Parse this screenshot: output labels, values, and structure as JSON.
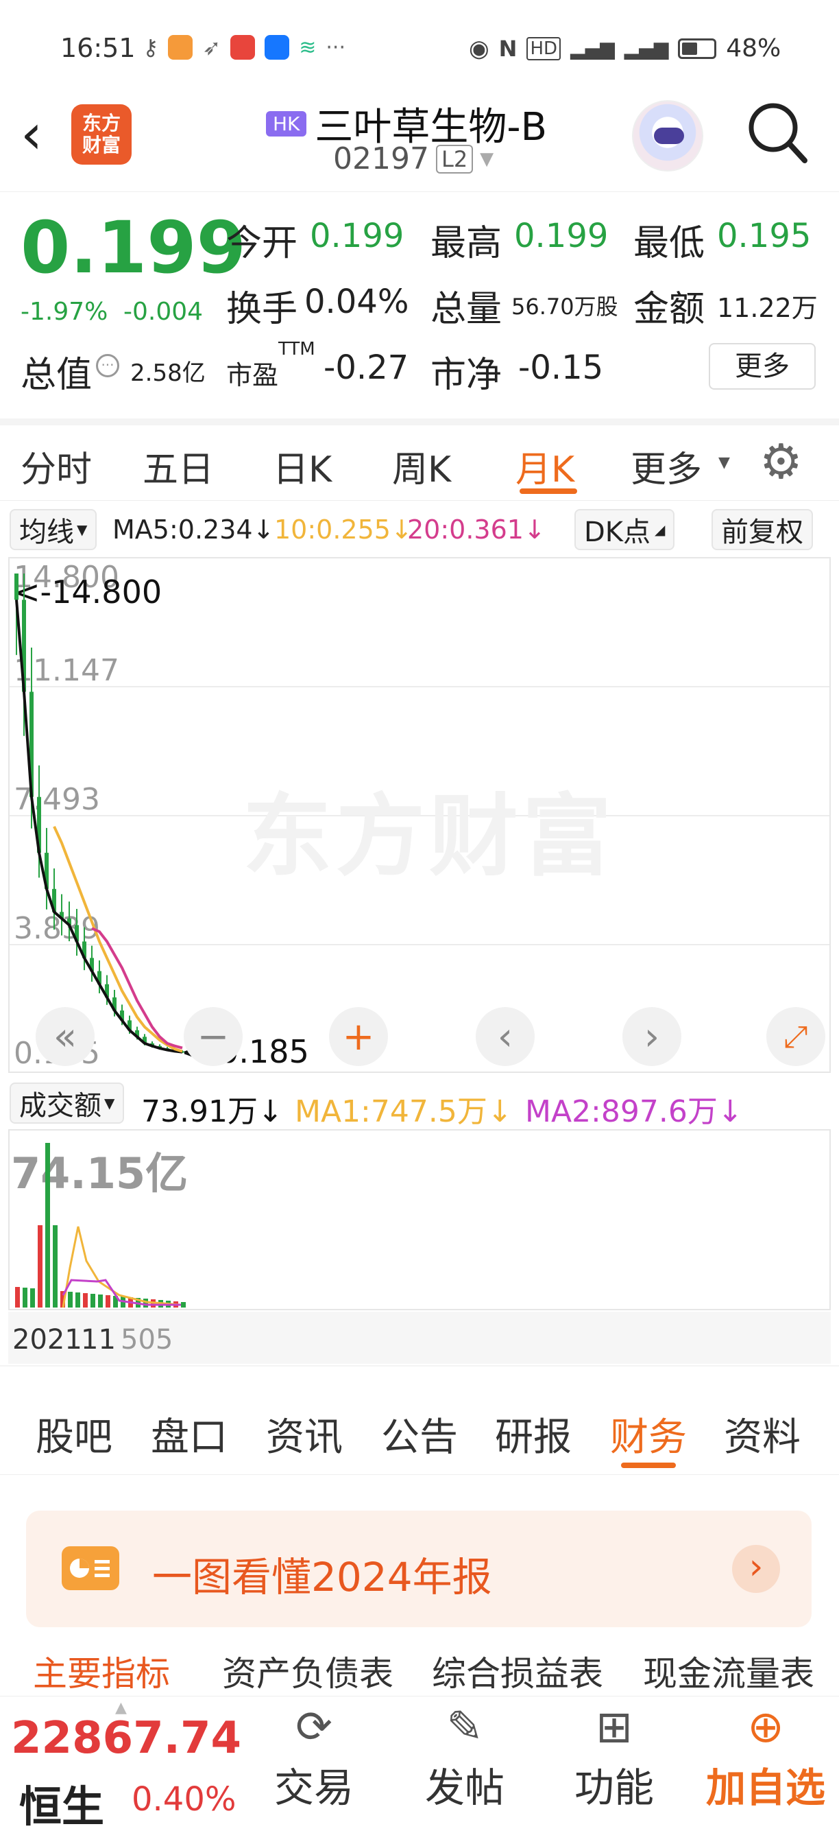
{
  "status": {
    "time": "16:51",
    "battery": "48%"
  },
  "header": {
    "market_badge": "HK",
    "stock_name": "三叶草生物-B",
    "code": "02197",
    "level": "L2",
    "logo_text": [
      "东方",
      "财富"
    ]
  },
  "quote": {
    "price": "0.199",
    "change_pct": "-1.97%",
    "change_abs": "-0.004",
    "open_label": "今开",
    "open": "0.199",
    "high_label": "最高",
    "high": "0.199",
    "low_label": "最低",
    "low": "0.195",
    "turnover_label": "换手",
    "turnover": "0.04%",
    "volume_label": "总量",
    "volume": "56.70万股",
    "amount_label": "金额",
    "amount": "11.22万",
    "mktcap_label": "总值",
    "mktcap": "2.58亿",
    "pe_label": "市盈",
    "pe_sup": "TTM",
    "pe": "-0.27",
    "pb_label": "市净",
    "pb": "-0.15",
    "more_button": "更多"
  },
  "tabs": {
    "items": [
      "分时",
      "五日",
      "日K",
      "周K",
      "月K",
      "更多"
    ],
    "active": "月K"
  },
  "ma_bar": {
    "dropdown": "均线",
    "ma5": "MA5:0.234↓",
    "ma10": "10:0.255↓",
    "ma20": "20:0.361↓",
    "dk": "DK点",
    "adjust": "前复权"
  },
  "chart": {
    "y_ticks": [
      "14.800",
      "11.147",
      "7.493",
      "3.839",
      "0.185"
    ],
    "max_marker": "<-14.800",
    "min_marker": "<-0.185",
    "watermark": "东方财富",
    "colors": {
      "ma5": "#111111",
      "ma10": "#f1b53a",
      "ma20": "#d43c8c",
      "up": "#e23b3b",
      "down": "#27a243"
    }
  },
  "chart_data": {
    "type": "line",
    "ylim": [
      0.185,
      14.8
    ],
    "series": [
      {
        "name": "MA5",
        "values": [
          14.0,
          11.2,
          8.0,
          6.3,
          5.2,
          4.5,
          4.3,
          4.1,
          3.6,
          3.1,
          2.7,
          2.3,
          1.9,
          1.5,
          1.2,
          0.9,
          0.7,
          0.5,
          0.42,
          0.35,
          0.3,
          0.26,
          0.234
        ]
      },
      {
        "name": "10",
        "values": [
          null,
          null,
          null,
          null,
          null,
          7.1,
          6.6,
          6.0,
          5.4,
          4.8,
          4.2,
          3.6,
          3.1,
          2.6,
          2.1,
          1.7,
          1.3,
          1.0,
          0.8,
          0.6,
          0.45,
          0.33,
          0.255
        ]
      },
      {
        "name": "20",
        "values": [
          null,
          null,
          null,
          null,
          null,
          null,
          null,
          null,
          null,
          null,
          4.0,
          3.9,
          3.6,
          3.2,
          2.8,
          2.3,
          1.8,
          1.4,
          1.0,
          0.7,
          0.5,
          0.42,
          0.361
        ]
      }
    ]
  },
  "volume": {
    "dropdown": "成交额",
    "value": "73.91万↓",
    "ma1": "MA1:747.5万↓",
    "ma2": "MA2:897.6万↓",
    "max_label": "74.15亿",
    "x_label": "2021",
    "x_label2": "11",
    "x_label3": "505"
  },
  "subtabs": {
    "items": [
      "股吧",
      "盘口",
      "资讯",
      "公告",
      "研报",
      "财务",
      "资料"
    ],
    "active": "财务"
  },
  "banner": {
    "text": "一图看懂2024年报"
  },
  "fin_tabs": {
    "items": [
      "主要指标",
      "资产负债表",
      "综合损益表",
      "现金流量表"
    ],
    "active": "主要指标"
  },
  "bottom": {
    "index_value": "22867.74",
    "index_name": "恒生",
    "index_change": "0.40%",
    "nav": [
      "交易",
      "发帖",
      "功能",
      "加自选"
    ]
  }
}
